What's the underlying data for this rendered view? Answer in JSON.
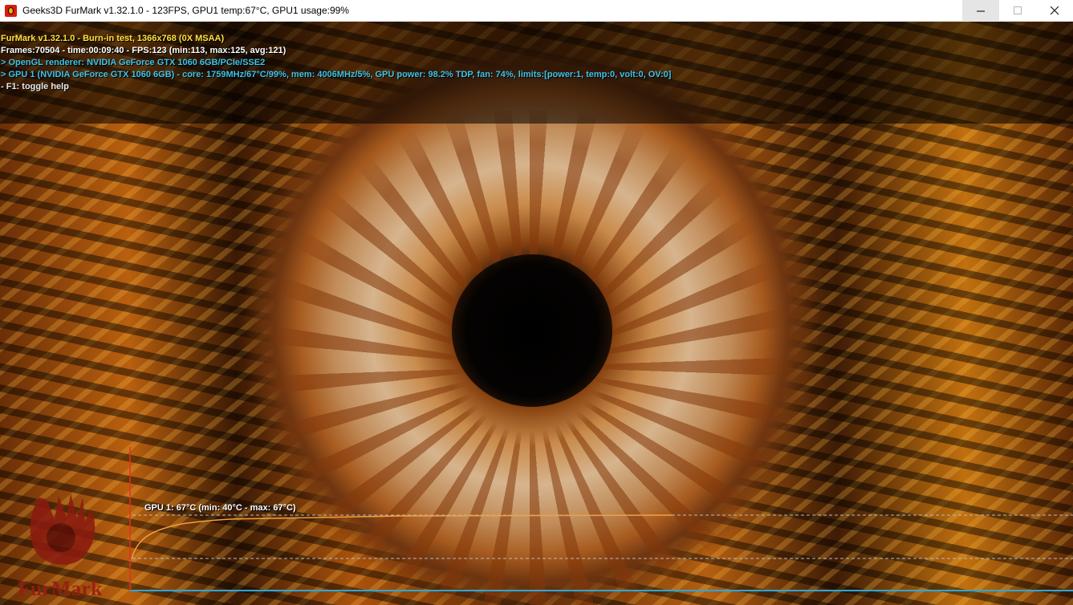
{
  "window": {
    "title": "Geeks3D FurMark v1.32.1.0 - 123FPS, GPU1 temp:67°C, GPU1 usage:99%",
    "app_icon": "furmark-app-icon",
    "controls": {
      "minimize": "minimize-icon",
      "maximize": "maximize-icon",
      "close": "close-icon"
    }
  },
  "osd": {
    "line1": "FurMark v1.32.1.0 - Burn-in test, 1366x768 (0X MSAA)",
    "line2": "Frames:70504 - time:00:09:40 - FPS:123 (min:113, max:125, avg:121)",
    "line3": "> OpenGL renderer: NVIDIA GeForce GTX 1060 6GB/PCIe/SSE2",
    "line4": "> GPU 1 (NVIDIA GeForce GTX 1060 6GB) - core: 1759MHz/67°C/99%, mem: 4006MHz/5%, GPU power: 98.2% TDP, fan: 74%, limits:[power:1, temp:0, volt:0, OV:0]",
    "line5": "- F1: toggle help",
    "colors": {
      "title": "#ffe23a",
      "stats": "#ffffff",
      "gpu_info": "#3fc3e8",
      "help": "#e8e8e8"
    }
  },
  "temperature_graph": {
    "label": "GPU 1: 67°C (min: 40°C - max: 67°C)",
    "current": 67,
    "min": 40,
    "max": 67,
    "line_color": "#f0a040",
    "axis_color": "#2aa8d8"
  },
  "logo": {
    "text": "FurMark",
    "icon": "furmark-logo"
  }
}
